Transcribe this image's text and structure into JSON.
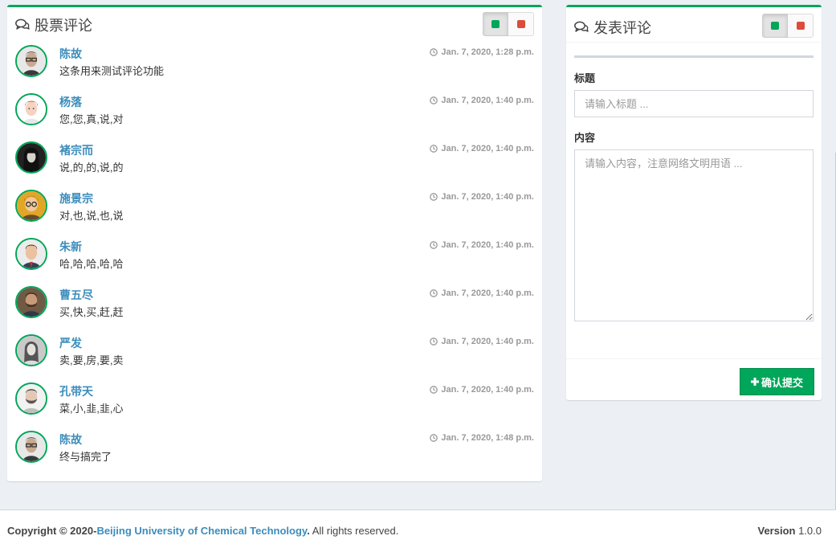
{
  "left_panel": {
    "title": "股票评论",
    "controls": {
      "left_color": "#00a65a",
      "right_color": "#dd4b39"
    }
  },
  "comments": [
    {
      "author": "陈故",
      "text": "这条用来测试评论功能",
      "time": "Jan. 7, 2020, 1:28 p.m.",
      "avatar": "man-glasses-icon"
    },
    {
      "author": "杨落",
      "text": "您,您,真,说,对",
      "time": "Jan. 7, 2020, 1:40 p.m.",
      "avatar": "red-hair-man-icon"
    },
    {
      "author": "褚宗而",
      "text": "说,的,的,说,的",
      "time": "Jan. 7, 2020, 1:40 p.m.",
      "avatar": "woman-dark-hair-icon"
    },
    {
      "author": "施景宗",
      "text": "对,也,说,也,说",
      "time": "Jan. 7, 2020, 1:40 p.m.",
      "avatar": "yellow-glasses-icon"
    },
    {
      "author": "朱新",
      "text": "哈,哈,哈,哈,哈",
      "time": "Jan. 7, 2020, 1:40 p.m.",
      "avatar": "man-suit-icon"
    },
    {
      "author": "曹五尽",
      "text": "买,快,买,赶,赶",
      "time": "Jan. 7, 2020, 1:40 p.m.",
      "avatar": "bearded-man-icon"
    },
    {
      "author": "严发",
      "text": "卖,要,房,要,卖",
      "time": "Jan. 7, 2020, 1:40 p.m.",
      "avatar": "woman-gray-icon"
    },
    {
      "author": "孔带天",
      "text": "菜,小,韭,韭,心",
      "time": "Jan. 7, 2020, 1:40 p.m.",
      "avatar": "man-beard-light-icon"
    },
    {
      "author": "陈故",
      "text": "终与搞完了",
      "time": "Jan. 7, 2020, 1:48 p.m.",
      "avatar": "man-glasses-icon"
    }
  ],
  "right_panel": {
    "title": "发表评论",
    "controls": {
      "left_color": "#00a65a",
      "right_color": "#dd4b39"
    },
    "title_label": "标题",
    "title_placeholder": "请输入标题 ...",
    "title_value": "",
    "content_label": "内容",
    "content_placeholder": "请输入内容，注意网络文明用语 ...",
    "content_value": "",
    "submit_label": "确认提交"
  },
  "footer": {
    "copyright_prefix": "Copyright © 2020-",
    "org": "Beijing University of Chemical Technology",
    "suffix": ". All rights reserved.",
    "version_label": "Version",
    "version_value": "1.0.0"
  },
  "colors": {
    "accent": "#00a65a",
    "link": "#3c8dbc",
    "danger": "#dd4b39"
  }
}
